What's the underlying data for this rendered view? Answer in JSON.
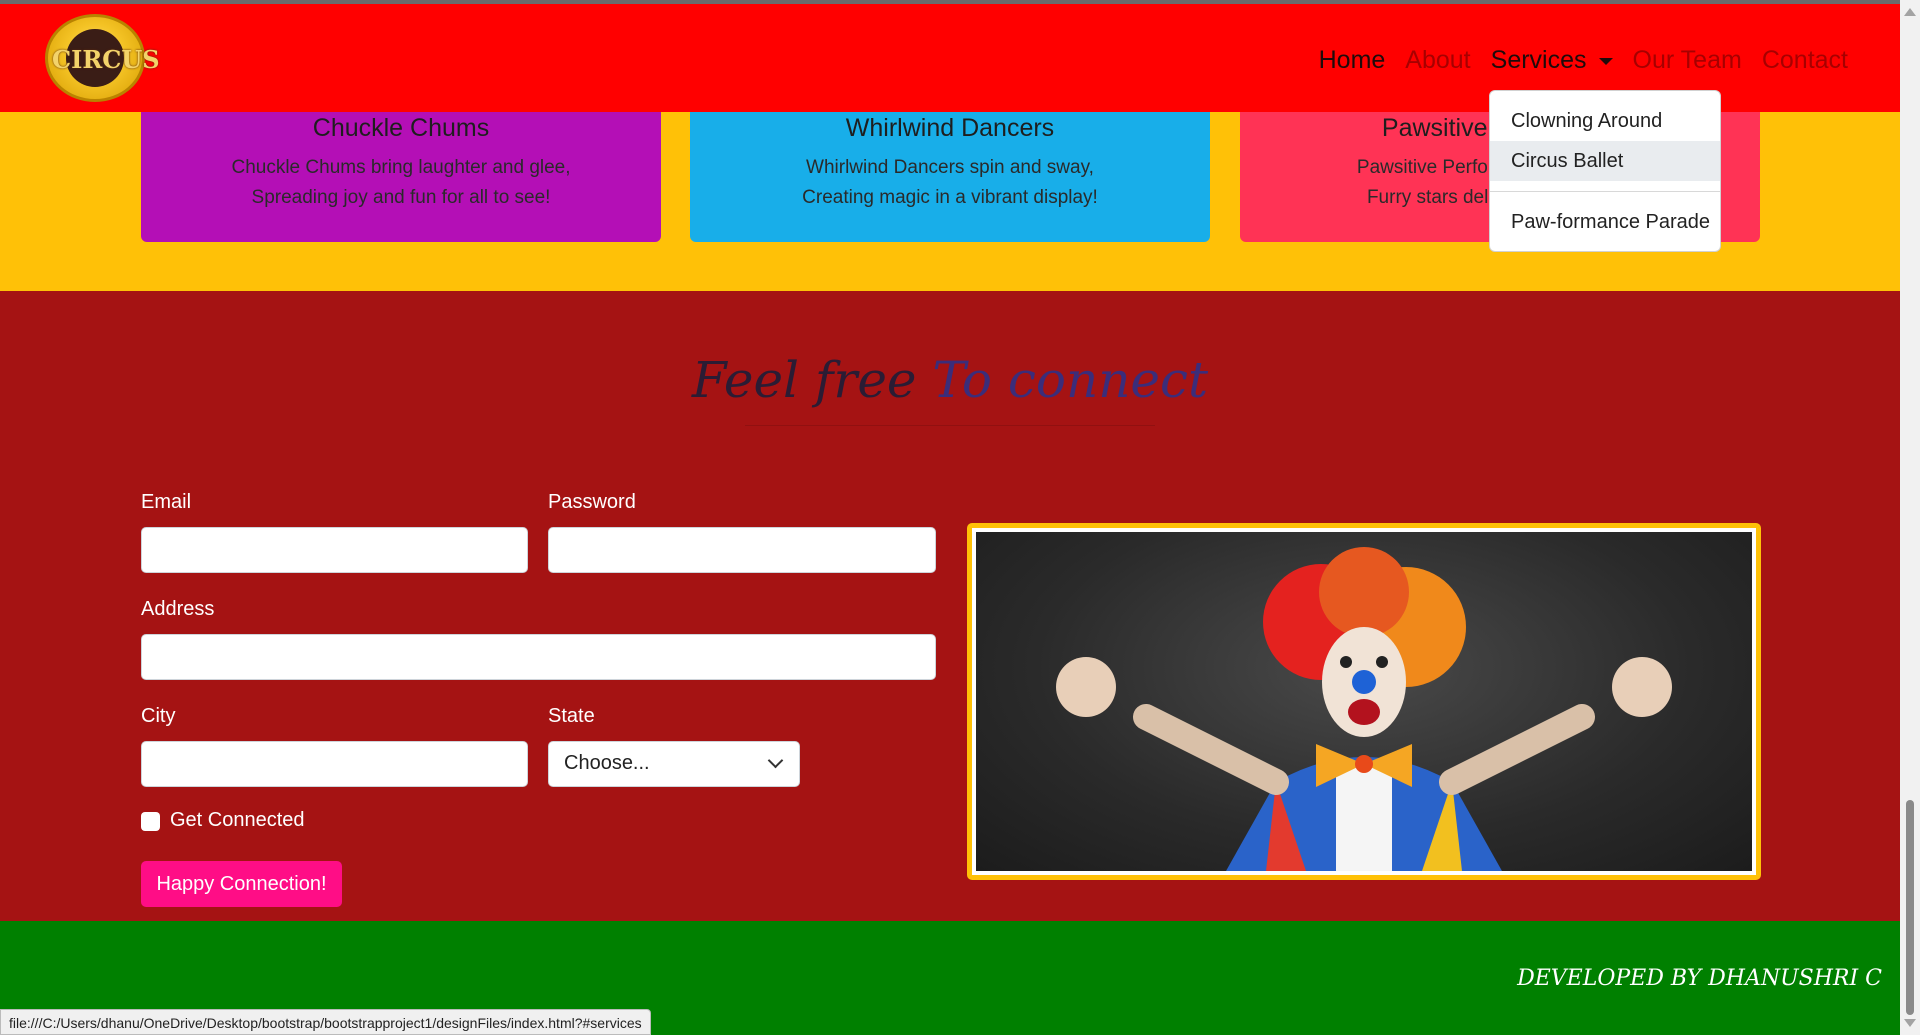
{
  "navbar": {
    "logo_text": "CIRCUS",
    "links": [
      {
        "label": "Home"
      },
      {
        "label": "About"
      },
      {
        "label": "Services"
      },
      {
        "label": "Our Team"
      },
      {
        "label": "Contact"
      }
    ],
    "dropdown": {
      "items": [
        "Clowning Around",
        "Circus Ballet",
        "Paw-formance Parade"
      ],
      "highlighted": "Circus Ballet"
    }
  },
  "services": {
    "cards": [
      {
        "title": "Chuckle Chums",
        "line1": "Chuckle Chums bring laughter and glee,",
        "line2": "Spreading joy and fun for all to see!",
        "color": "#b40fb6"
      },
      {
        "title": "Whirlwind Dancers",
        "line1": "Whirlwind Dancers spin and sway,",
        "line2": "Creating magic in a vibrant display!",
        "color": "#18aee9"
      },
      {
        "title": "Pawsitive Performers",
        "line1": "Pawsitive Performers, fur and fun,",
        "line2": "Furry stars delighting everyone!",
        "color": "#ff3355"
      }
    ]
  },
  "contact": {
    "heading_part1": "Feel free",
    "heading_part2": "To connect",
    "email_label": "Email",
    "password_label": "Password",
    "address_label": "Address",
    "city_label": "City",
    "state_label": "State",
    "state_selected": "Choose...",
    "checkbox_label": "Get Connected",
    "submit_label": "Happy Connection!"
  },
  "footer": {
    "credit": "DEVELOPED BY DHANUSHRI C"
  },
  "status_bar": {
    "url": "file:///C:/Users/dhanu/OneDrive/Desktop/bootstrap/bootstrapproject1/designFiles/index.html?#services"
  },
  "colors": {
    "navbar": "#ff0000",
    "services_bg": "#ffc107",
    "contact_bg": "#a51313",
    "footer_bg": "#008000",
    "button": "#ff0d86"
  }
}
